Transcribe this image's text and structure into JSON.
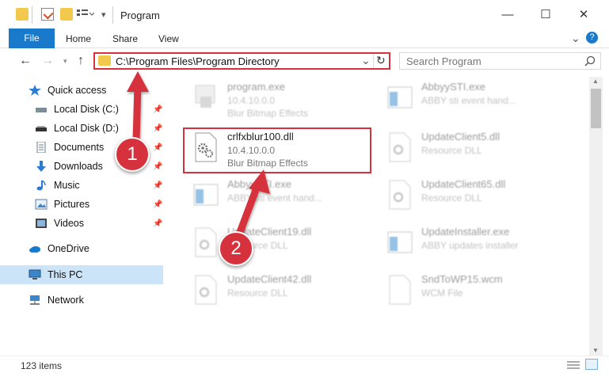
{
  "window": {
    "title": "Program",
    "minimize": "—",
    "maximize": "☐",
    "close": "✕"
  },
  "ribbon": {
    "file": "File",
    "tabs": [
      "Home",
      "Share",
      "View"
    ],
    "expand": "⌄",
    "help": "?"
  },
  "nav": {
    "back": "←",
    "forward": "→",
    "up": "↑"
  },
  "address": {
    "path": "C:\\Program Files\\Program Directory",
    "dropdown": "⌄",
    "refresh": "↻"
  },
  "search": {
    "placeholder": "Search Program"
  },
  "sidebar": {
    "items": [
      {
        "label": "Quick access",
        "icon": "star-icon"
      },
      {
        "label": "Local Disk (C:)",
        "icon": "drive-icon",
        "pinned": true
      },
      {
        "label": "Local Disk (D:)",
        "icon": "drive-icon",
        "pinned": true
      },
      {
        "label": "Documents",
        "icon": "document-icon",
        "pinned": true
      },
      {
        "label": "Downloads",
        "icon": "download-icon",
        "pinned": true
      },
      {
        "label": "Music",
        "icon": "music-icon",
        "pinned": true
      },
      {
        "label": "Pictures",
        "icon": "picture-icon",
        "pinned": true
      },
      {
        "label": "Videos",
        "icon": "video-icon",
        "pinned": true
      },
      {
        "label": "OneDrive",
        "icon": "cloud-icon"
      },
      {
        "label": "This PC",
        "icon": "computer-icon",
        "selected": true
      },
      {
        "label": "Network",
        "icon": "network-icon"
      }
    ]
  },
  "files": [
    {
      "name": "program.exe",
      "line1": "10.4.10.0.0",
      "line2": "Blur Bitmap Effects"
    },
    {
      "name": "AbbyySTI.exe",
      "line1": "ABBY sti event hand...",
      "line2": ""
    },
    {
      "name": "crlfxblur100.dll",
      "line1": "10.4.10.0.0",
      "line2": "Blur Bitmap Effects"
    },
    {
      "name": "UpdateClient5.dll",
      "line1": "Resource DLL",
      "line2": ""
    },
    {
      "name": "AbbyySTI.exe",
      "line1": "ABBY sti event hand...",
      "line2": ""
    },
    {
      "name": "UpdateClient65.dll",
      "line1": "Resource DLL",
      "line2": ""
    },
    {
      "name": "UpdateClient19.dll",
      "line1": "Resource DLL",
      "line2": ""
    },
    {
      "name": "UpdateInstaller.exe",
      "line1": "ABBY updates installer",
      "line2": ""
    },
    {
      "name": "UpdateClient42.dll",
      "line1": "Resource DLL",
      "line2": ""
    },
    {
      "name": "SndToWP15.wcm",
      "line1": "WCM File",
      "line2": ""
    }
  ],
  "status": {
    "count": "123 items"
  },
  "callouts": [
    "1",
    "2"
  ],
  "colors": {
    "accent": "#1979ca",
    "highlight": "#d6323d",
    "selected": "#cce4f7"
  }
}
